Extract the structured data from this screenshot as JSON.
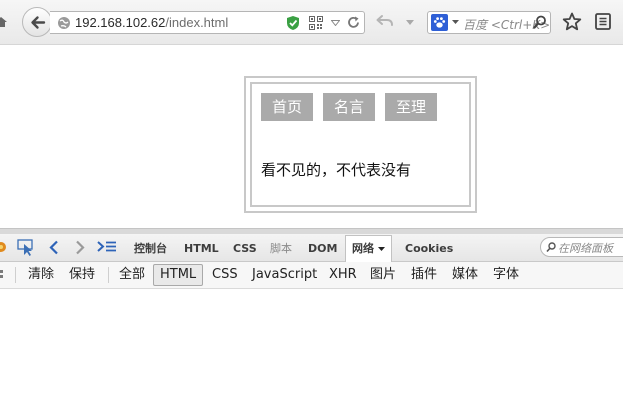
{
  "browser": {
    "url_host": "192.168.102.62",
    "url_path": "/index.html",
    "search_placeholder": "百度 <Ctrl+K>"
  },
  "page": {
    "nav": [
      "首页",
      "名言",
      "至理"
    ],
    "content": "看不见的，不代表没有"
  },
  "devtools": {
    "tabs": {
      "console": "控制台",
      "html": "HTML",
      "css": "CSS",
      "script": "脚本",
      "dom": "DOM",
      "net": "网络",
      "cookies": "Cookies"
    },
    "search_placeholder": "在网络面板",
    "filters": {
      "clear": "清除",
      "persist": "保持",
      "all": "全部",
      "html": "HTML",
      "css": "CSS",
      "js": "JavaScript",
      "xhr": "XHR",
      "images": "图片",
      "plugins": "插件",
      "media": "媒体",
      "fonts": "字体"
    },
    "active_tab": "net",
    "active_filter": "html"
  },
  "colors": {
    "nav_tab_bg": "#aaaaaa",
    "nav_tab_text": "#ffffff",
    "frame_border": "#c8c8c8",
    "shield_green": "#3aa043",
    "baidu_blue": "#2e5fd6"
  }
}
